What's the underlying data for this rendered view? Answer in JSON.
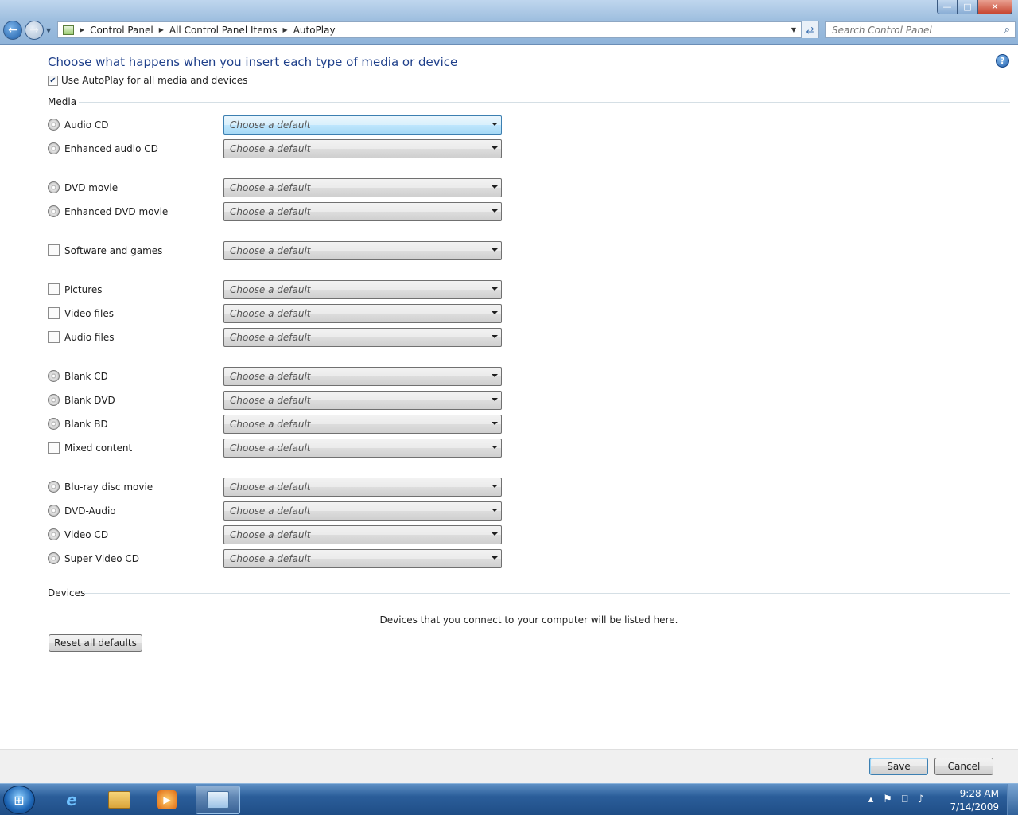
{
  "window": {
    "controls": {
      "minimize": "—",
      "maximize": "□",
      "close": "✕"
    }
  },
  "nav": {
    "back_icon": "back-arrow-icon",
    "forward_icon": "forward-arrow-icon",
    "breadcrumbs": [
      "Control Panel",
      "All Control Panel Items",
      "AutoPlay"
    ],
    "search_placeholder": "Search Control Panel"
  },
  "main": {
    "heading": "Choose what happens when you insert each type of media or device",
    "use_autoplay": {
      "label": "Use AutoPlay for all media and devices",
      "checked": true
    },
    "media_section_label": "Media",
    "dropdown_placeholder": "Choose a default",
    "media": [
      {
        "label": "Audio CD",
        "icon": "audio-cd-icon"
      },
      {
        "label": "Enhanced audio CD",
        "icon": "enhanced-audio-cd-icon"
      },
      {
        "label": "DVD movie",
        "icon": "dvd-movie-icon"
      },
      {
        "label": "Enhanced DVD movie",
        "icon": "enhanced-dvd-movie-icon"
      },
      {
        "label": "Software and games",
        "icon": "software-games-icon"
      },
      {
        "label": "Pictures",
        "icon": "pictures-icon"
      },
      {
        "label": "Video files",
        "icon": "video-files-icon"
      },
      {
        "label": "Audio files",
        "icon": "audio-files-icon"
      },
      {
        "label": "Blank CD",
        "icon": "blank-cd-icon"
      },
      {
        "label": "Blank DVD",
        "icon": "blank-dvd-icon"
      },
      {
        "label": "Blank BD",
        "icon": "blank-bd-icon"
      },
      {
        "label": "Mixed content",
        "icon": "mixed-content-icon"
      },
      {
        "label": "Blu-ray disc movie",
        "icon": "bluray-movie-icon"
      },
      {
        "label": "DVD-Audio",
        "icon": "dvd-audio-icon"
      },
      {
        "label": "Video CD",
        "icon": "video-cd-icon"
      },
      {
        "label": "Super Video CD",
        "icon": "super-video-cd-icon"
      }
    ],
    "devices_section_label": "Devices",
    "devices_message": "Devices that you connect to your computer will be listed here.",
    "reset_button": "Reset all defaults"
  },
  "footer": {
    "save_button": "Save",
    "cancel_button": "Cancel"
  },
  "taskbar": {
    "clock_time": "9:28 AM",
    "clock_date": "7/14/2009",
    "pinned": [
      "internet-explorer-icon",
      "windows-explorer-icon",
      "media-player-icon",
      "control-panel-icon"
    ]
  }
}
